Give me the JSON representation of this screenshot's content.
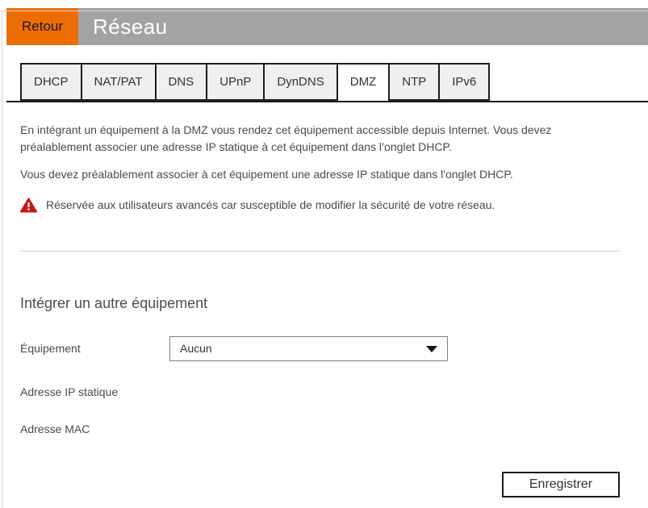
{
  "colors": {
    "accent": "#ed6d05",
    "header_gray": "#a3a3a3",
    "warning_red": "#c41a12"
  },
  "header": {
    "back_label": "Retour",
    "title": "Réseau"
  },
  "tabs": {
    "items": [
      {
        "label": "DHCP",
        "active": false
      },
      {
        "label": "NAT/PAT",
        "active": false
      },
      {
        "label": "DNS",
        "active": false
      },
      {
        "label": "UPnP",
        "active": false
      },
      {
        "label": "DynDNS",
        "active": false
      },
      {
        "label": "DMZ",
        "active": true
      },
      {
        "label": "NTP",
        "active": false
      },
      {
        "label": "IPv6",
        "active": false
      }
    ]
  },
  "content": {
    "paragraph1": "En intégrant un équipement à la DMZ vous rendez cet équipement accessible depuis Internet. Vous devez préalablement associer une adresse IP statique à cet équipement dans l’onglet DHCP.",
    "paragraph2": "Vous devez préalablement associer à cet équipement une adresse IP statique dans l'onglet DHCP.",
    "warning_text": "Réservée aux utilisateurs avancés car susceptible de modifier la sécurité de votre réseau.",
    "section_title": "Intégrer un autre équipement"
  },
  "form": {
    "device_label": "Équipement",
    "device_value": "Aucun",
    "ip_label": "Adresse IP statique",
    "mac_label": "Adresse MAC",
    "save_label": "Enregistrer"
  }
}
